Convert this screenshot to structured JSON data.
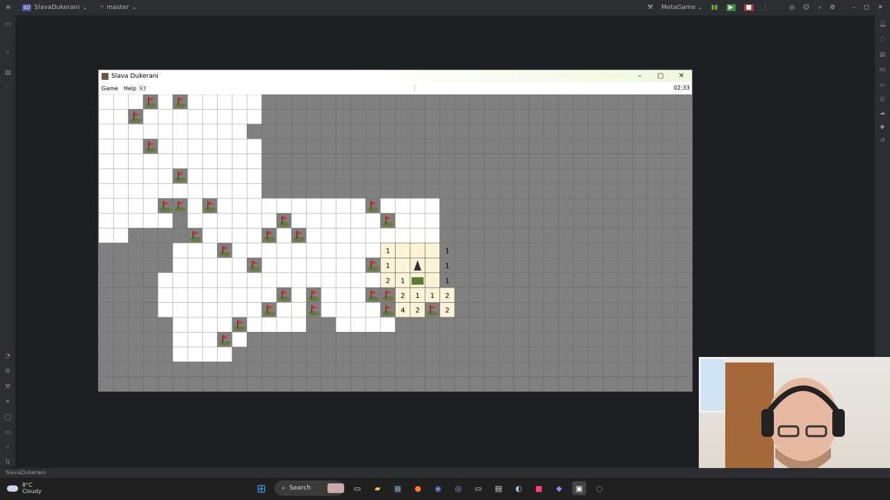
{
  "ide": {
    "project": "SlavaDukerani",
    "project_badge": "SD",
    "branch": "master",
    "run_config": "MetaGame",
    "status_path": "SlavaDukerani"
  },
  "window": {
    "title": "Slava Dukerani"
  },
  "menu": {
    "game": "Game",
    "help": "Help",
    "mines_left": "93",
    "timer": "02:33"
  },
  "board_data": {
    "cols": 40,
    "rows": 20,
    "legend": "W=revealed empty, G=unrevealed, F=flag, Y=revealed (highlighted), N=revealed number, P=player",
    "grid": [
      "WWWFWFWWWWWGGGGGGGGGGGGGGGGGGGGGGGGGGGGG",
      "WWFWWWWWWWWGGGGGGGGGGGGGGGGGGGGGGGGGGGGG",
      "WWWWWWWWWWGGGGGGGGGGGGGGGGGGGGGGGGGGGGGG",
      "WWWFWWWWWWWGGGGGGGGGGGGGGGGGGGGGGGGGGGGG",
      "WWWWWWWWWWWGGGGGGGGGGGGGGGGGGGGGGGGGGGGG",
      "WWWWWFWWWWWGGGGGGGGGGGGGGGGGGGGGGGGGGGGG",
      "WWWWWWWWWWWGGGGGGGGGGGGGGGGGGGGGGGGGGGGG",
      "WWWWFFWFWWWWWWWWWWFWWWWGGGGGGGGGGGGGGGGG",
      "WWWWWGWWWWWWFWWWWWWFWWWGGGGGGGGGGGGGGGGG",
      "WWGGGGFWWWWFWFWWWWWWWWWGGGGGGGGGGGGGGGGG",
      "GGGGGWWWFWWWWWWWWWWNYYNGGGGGGGGGGGGGGGGG",
      "GGGGGWWWWWFWWWWWWWFNYPNGGGGGGGGGGGGGGGGG",
      "GGGGWWWWWWWWWWWWWWWNNTNGGGGGGGGGGGGGGGGG",
      "GGGGWWWWWWWWFWFWWWFFNNNNGGGGGGGGGGGGGGGGG",
      "GGGGWWWWWWWFWWFWWWWFNNFNGGGGGGGGGGGGGGGGG",
      "GGGGGWWWWFWWWWGGWWWWGGGGGGGGGGGGGGGGGGGG",
      "GGGGGWWWFWGGGGGGGGGGGGGGGGGGGGGGGGGGGGGGG",
      "GGGGGWWWWGGGGGGGGGGGGGGGGGGGGGGGGGGGGGGGG",
      "GGGGGGGGGGGGGGGGGGGGGGGGGGGGGGGGGGGGGGGGGG",
      "GGGGGGGGGGGGGGGGGGGGGGGGGGGGGGGGGGGGGGGGGG"
    ],
    "numbers": [
      {
        "r": 10,
        "c": 19,
        "v": "1"
      },
      {
        "r": 10,
        "c": 23,
        "v": "1"
      },
      {
        "r": 11,
        "c": 19,
        "v": "1"
      },
      {
        "r": 11,
        "c": 23,
        "v": "1"
      },
      {
        "r": 12,
        "c": 19,
        "v": "2"
      },
      {
        "r": 12,
        "c": 20,
        "v": "1"
      },
      {
        "r": 12,
        "c": 23,
        "v": "1"
      },
      {
        "r": 13,
        "c": 20,
        "v": "2"
      },
      {
        "r": 13,
        "c": 21,
        "v": "1"
      },
      {
        "r": 13,
        "c": 22,
        "v": "1"
      },
      {
        "r": 13,
        "c": 23,
        "v": "2"
      },
      {
        "r": 14,
        "c": 20,
        "v": "4"
      },
      {
        "r": 14,
        "c": 21,
        "v": "2"
      },
      {
        "r": 14,
        "c": 23,
        "v": "2"
      }
    ]
  },
  "taskbar": {
    "weather_temp": "8°C",
    "weather_desc": "Cloudy",
    "search_label": "Search"
  },
  "colors": {
    "revealed": "#ffffff",
    "unrevealed": "#808080",
    "highlight": "#fdf3d6",
    "grid_line": "#6e6e6e"
  }
}
